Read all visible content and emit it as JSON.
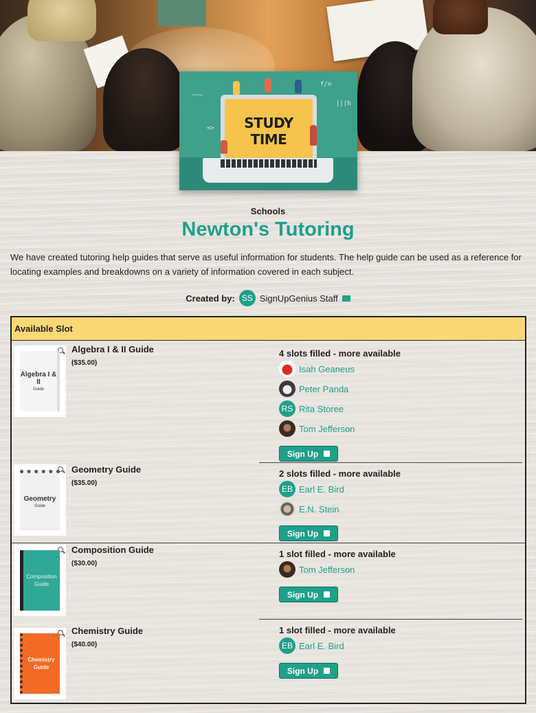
{
  "banner": {
    "card_text": "STUDY TIME"
  },
  "header": {
    "category": "Schools",
    "title": "Newton's Tutoring",
    "description": "We have created tutoring help guides that serve as useful information for students. The help guide can be used as a reference for locating examples and breakdowns on a variety of information covered in each subject.",
    "created_by_label": "Created by:",
    "creator_initials": "SS",
    "creator_name": "SignUpGenius Staff",
    "creator_icon": "mail-icon"
  },
  "table": {
    "header": "Available Slot",
    "signup_label": "Sign Up",
    "items": [
      {
        "name": "Algebra I & II Guide",
        "price": "($35.00)",
        "cover_title": "Algebra I & II",
        "cover_sub": "Guide",
        "status": "4 slots filled - more available",
        "people": [
          {
            "name": "Isah Geaneus",
            "avatar": "apple"
          },
          {
            "name": "Peter Panda",
            "avatar": "panda"
          },
          {
            "name": "Rita Storee",
            "avatar": "initials",
            "initials": "RS"
          },
          {
            "name": "Tom Jefferson",
            "avatar": "tom"
          }
        ]
      },
      {
        "name": "Geometry Guide",
        "price": "($35.00)",
        "cover_title": "Geometry",
        "cover_sub": "Guide",
        "status": "2 slots filled - more available",
        "people": [
          {
            "name": "Earl E. Bird",
            "avatar": "initials",
            "initials": "EB"
          },
          {
            "name": "E.N. Stein",
            "avatar": "stein"
          }
        ]
      },
      {
        "name": "Composition Guide",
        "price": "($30.00)",
        "cover_title": "Composition Guide",
        "cover_sub": "",
        "status": "1 slot filled - more available",
        "people": [
          {
            "name": "Tom Jefferson",
            "avatar": "tom"
          }
        ]
      },
      {
        "name": "Chemistry Guide",
        "price": "($40.00)",
        "cover_title": "Chemistry Guide",
        "cover_sub": "",
        "status": "1 slot filled - more available",
        "people": [
          {
            "name": "Earl E. Bird",
            "avatar": "initials",
            "initials": "EB"
          }
        ]
      }
    ]
  }
}
